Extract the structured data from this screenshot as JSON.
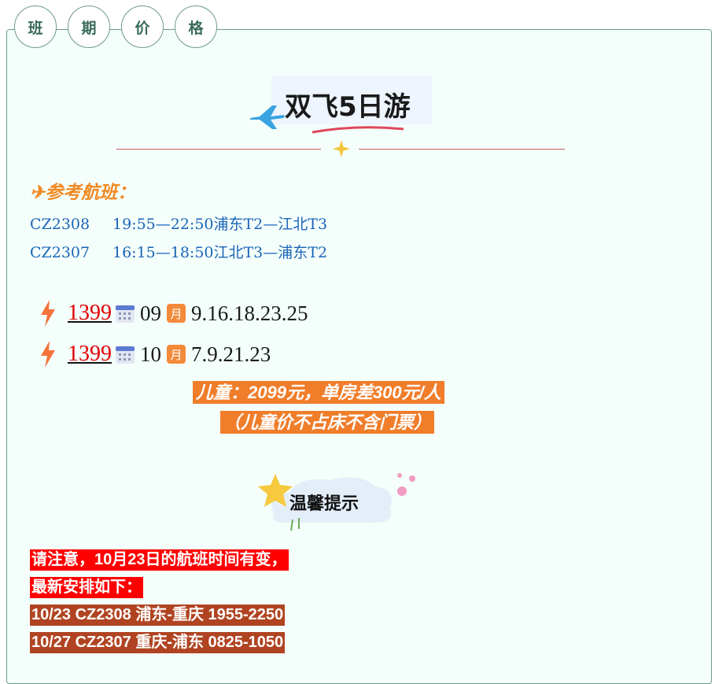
{
  "tabs": [
    "班",
    "期",
    "价",
    "格"
  ],
  "title": "双飞5日游",
  "flights": {
    "heading": "✈参考航班：",
    "rows": [
      {
        "code": "CZ2308",
        "detail": "19:55—22:50浦东T2—江北T3"
      },
      {
        "code": "CZ2307",
        "detail": "16:15—18:50江北T3—浦东T2"
      }
    ]
  },
  "prices": [
    {
      "price": "1399",
      "month": "09",
      "month_icon": "月",
      "dates": "9.16.18.23.25"
    },
    {
      "price": "1399",
      "month": "10",
      "month_icon": "月",
      "dates": "7.9.21.23"
    }
  ],
  "child_note": {
    "line1": "儿童：2099元，单房差300元/人",
    "line2": "（儿童价不占床不含门票）"
  },
  "tips": {
    "title": "温馨提示"
  },
  "notices": [
    "请注意，10月23日的航班时间有变，",
    "最新安排如下：",
    "10/23 CZ2308 浦东-重庆 1955-2250",
    "10/27 CZ2307 重庆-浦东 0825-1050"
  ],
  "colors": {
    "price": "#e00000",
    "flight_text": "#1a64b8",
    "flight_heading": "#f08a24",
    "child_bg": "#f07d2a",
    "notice_red": "#ff0000",
    "notice_brown": "#b04422"
  },
  "icons": [
    "airplane-icon",
    "sparkle-star-icon",
    "lightning-icon",
    "calendar-icon",
    "month-badge-icon",
    "star-cloud-icon"
  ]
}
